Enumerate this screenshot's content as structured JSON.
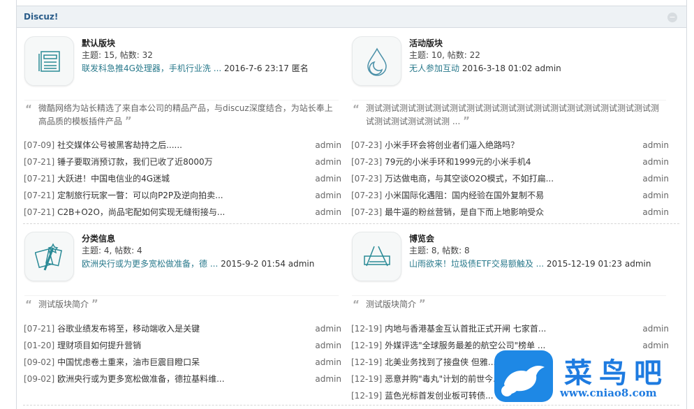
{
  "header": {
    "title": "Discuz!",
    "collapse_icon": "collapse-icon"
  },
  "forums": [
    {
      "name": "默认版块",
      "stats": "主题: 15, 帖数: 32",
      "last_title": "联发科急推4G处理器，手机行业洗 ...",
      "last_meta": "2016-7-6 23:17 匿名",
      "icon": "document-icon",
      "description": "微酷网络为站长精选了来自本公司的精品产品，与discuz深度结合，为站长奉上高品质的模板插件产品",
      "threads": [
        {
          "date": "[07-09]",
          "title": "社交媒体公号被黑客劫持之后......",
          "author": "admin"
        },
        {
          "date": "[07-21]",
          "title": "锤子要取消预订款，我们已收了近8000万",
          "author": "admin"
        },
        {
          "date": "[07-21]",
          "title": "大跃进！中国电信业的4G迷城",
          "author": "admin"
        },
        {
          "date": "[07-21]",
          "title": "定制旅行玩家一瞥：可以向P2P及逆向拍卖...",
          "author": "admin"
        },
        {
          "date": "[07-21]",
          "title": "C2B+O2O，尚品宅配如何实现无缝衔接与...",
          "author": "admin"
        }
      ]
    },
    {
      "name": "活动版块",
      "stats": "主题: 10, 帖数: 22",
      "last_title": "无人参加互动",
      "last_meta": "2016-3-18 01:02 admin",
      "icon": "water-drop-icon",
      "description": "测试测试测试测试测试测试测试测试测试测试测试测试测试测试测试测试测试测试测试测试测试测试测 ...",
      "threads": [
        {
          "date": "[07-23]",
          "title": "小米手环会将创业者们逼入绝路吗？",
          "author": "admin"
        },
        {
          "date": "[07-23]",
          "title": "79元的小米手环和1999元的小米手机4",
          "author": "admin"
        },
        {
          "date": "[07-23]",
          "title": "万达做电商，与其空谈O2O模式，不如打扁...",
          "author": "admin"
        },
        {
          "date": "[07-23]",
          "title": "小米国际化遇阻：国内经验在国外复制不易",
          "author": "admin"
        },
        {
          "date": "[07-23]",
          "title": "最牛逼的粉丝营销，是自下而上地影响受众",
          "author": "admin"
        }
      ]
    },
    {
      "name": "分类信息",
      "stats": "主题: 4, 帖数: 4",
      "last_title": "欧洲央行或为更多宽松做准备，德 ...",
      "last_meta": "2015-9-2 01:54 admin",
      "icon": "magic-wand-icon",
      "description": "测试版块简介",
      "threads": [
        {
          "date": "[07-21]",
          "title": "谷歌业绩发布将至，移动端收入是关键",
          "author": "admin"
        },
        {
          "date": "[01-20]",
          "title": "理财项目如何提升营销",
          "author": "admin"
        },
        {
          "date": "[09-02]",
          "title": "中国忧虑卷土重来，油市巨震目瞪口呆",
          "author": "admin"
        },
        {
          "date": "[09-02]",
          "title": "欧洲央行或为更多宽松做准备，德拉基料维...",
          "author": "admin"
        }
      ]
    },
    {
      "name": "博览会",
      "stats": "主题: 8, 帖数: 8",
      "last_title": "山雨欲来！垃圾债ETF交易额触及 ...",
      "last_meta": "2015-12-19 01:23 admin",
      "icon": "app-store-icon",
      "description": "测试版块简介",
      "threads": [
        {
          "date": "[12-19]",
          "title": "内地与香港基金互认首批正式开闸 七家首...",
          "author": "admin"
        },
        {
          "date": "[12-19]",
          "title": "外媒评选\"全球服务最差的航空公司\"榜单 ...",
          "author": "admin"
        },
        {
          "date": "[12-19]",
          "title": "北美业务找到了接盘侠 但雅...",
          "author": ""
        },
        {
          "date": "[12-19]",
          "title": "恶意并购\"毒丸\"计划的前世今...",
          "author": ""
        },
        {
          "date": "[12-19]",
          "title": "蓝色光标首发创业板可转债...",
          "author": ""
        }
      ]
    }
  ],
  "quote_open": "“",
  "quote_close": "”",
  "watermark": {
    "name": "菜鸟吧",
    "url": "www.cniao8.com",
    "color": "#1e88e5"
  }
}
